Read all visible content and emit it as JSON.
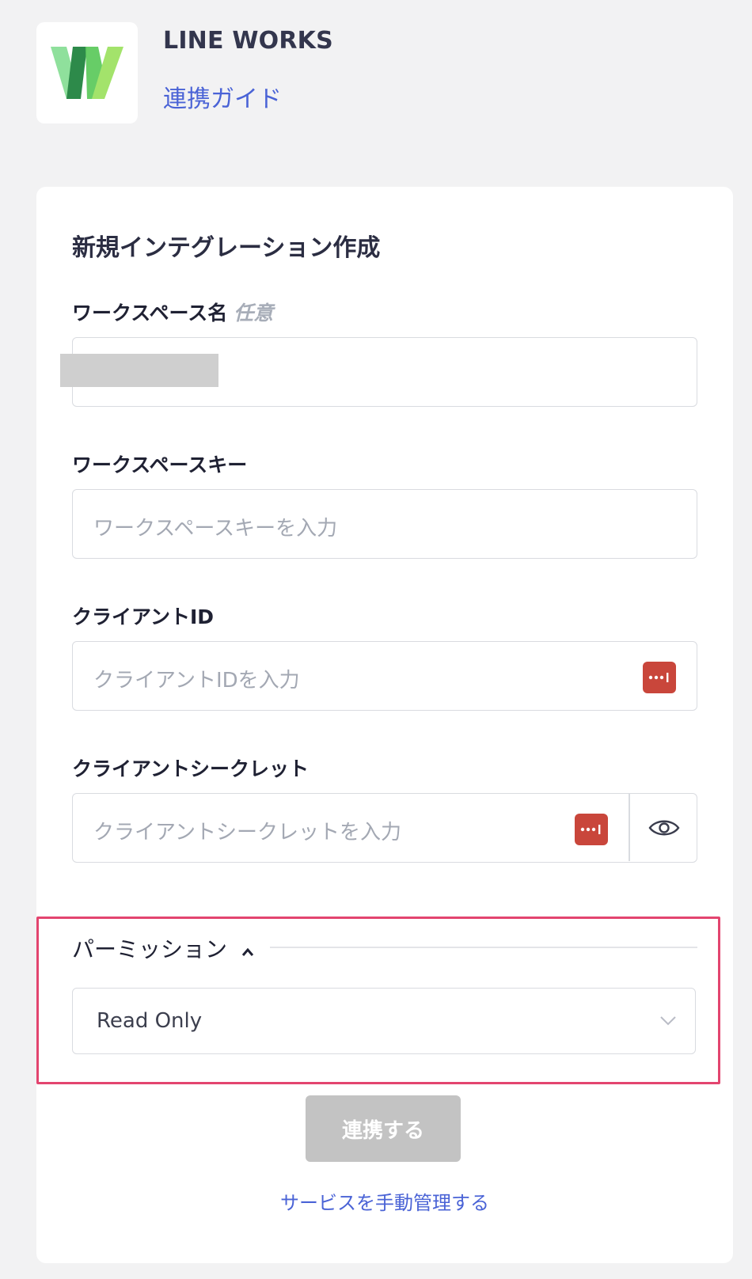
{
  "app": {
    "name": "LINE WORKS",
    "guide_link": "連携ガイド",
    "logo_icon": "line-works-logo",
    "logo_colors": {
      "light": "#7fd98c",
      "dark": "#2d8a4a",
      "mid": "#5fca5f"
    }
  },
  "form": {
    "title": "新規インテグレーション作成",
    "workspace_name": {
      "label": "ワークスペース名",
      "optional": "任意",
      "value": ""
    },
    "workspace_key": {
      "label": "ワークスペースキー",
      "placeholder": "ワークスペースキーを入力",
      "value": ""
    },
    "client_id": {
      "label": "クライアントID",
      "placeholder": "クライアントIDを入力",
      "value": "",
      "password_manager_icon": "password-manager-icon"
    },
    "client_secret": {
      "label": "クライアントシークレット",
      "placeholder": "クライアントシークレットを入力",
      "value": "",
      "password_manager_icon": "password-manager-icon",
      "toggle_icon": "eye-icon"
    },
    "permission": {
      "label": "パーミッション",
      "expanded": true,
      "selected": "Read Only"
    },
    "submit_label": "連携する",
    "manual_link": "サービスを手動管理する"
  },
  "colors": {
    "accent_link": "#4a63d6",
    "highlight_border": "#e3456f",
    "disabled_button": "#c3c3c3",
    "password_icon": "#c9463b"
  }
}
